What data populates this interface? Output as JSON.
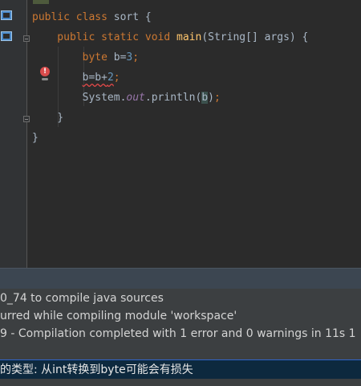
{
  "editor": {
    "lines": [
      {
        "tokens": [
          {
            "t": "public class ",
            "c": "kw"
          },
          {
            "t": "sort ",
            "c": "var"
          },
          {
            "t": "{",
            "c": "var"
          }
        ]
      },
      {
        "tokens": [
          {
            "t": "    public static void ",
            "c": "kw"
          },
          {
            "t": "main",
            "c": "fn"
          },
          {
            "t": "(String[] args) {",
            "c": "var"
          }
        ]
      },
      {
        "tokens": [
          {
            "t": "        byte ",
            "c": "kw"
          },
          {
            "t": "b",
            "c": "var"
          },
          {
            "t": "=",
            "c": "var"
          },
          {
            "t": "3",
            "c": "num"
          },
          {
            "t": ";",
            "c": "punct"
          }
        ]
      },
      {
        "tokens": [
          {
            "t": "        ",
            "c": "var"
          },
          {
            "t": "b=b+",
            "c": "var squiggle"
          },
          {
            "t": "2",
            "c": "num squiggle"
          },
          {
            "t": ";",
            "c": "punct"
          }
        ]
      },
      {
        "tokens": [
          {
            "t": "        System.",
            "c": "var"
          },
          {
            "t": "out",
            "c": "field"
          },
          {
            "t": ".println(",
            "c": "var"
          },
          {
            "t": "b",
            "c": "var caret-box"
          },
          {
            "t": ")",
            "c": "var"
          },
          {
            "t": ";",
            "c": "punct"
          }
        ]
      },
      {
        "tokens": [
          {
            "t": "    }",
            "c": "var"
          }
        ]
      },
      {
        "tokens": [
          {
            "t": "}",
            "c": "var"
          }
        ]
      }
    ],
    "error_marker": "!"
  },
  "messages": {
    "line1": "0_74 to compile java sources",
    "line2": "urred while compiling module 'workspace'",
    "line3": "9 - Compilation completed with 1 error and 0 warnings in 11s 1"
  },
  "status": {
    "text": "的类型: 从int转换到byte可能会有损失"
  },
  "colors": {
    "background": "#2b2b2b",
    "keyword": "#cc7832",
    "method": "#ffc66d",
    "number": "#6897bb",
    "status_bar": "#0d293e",
    "error": "#d94c4c"
  }
}
